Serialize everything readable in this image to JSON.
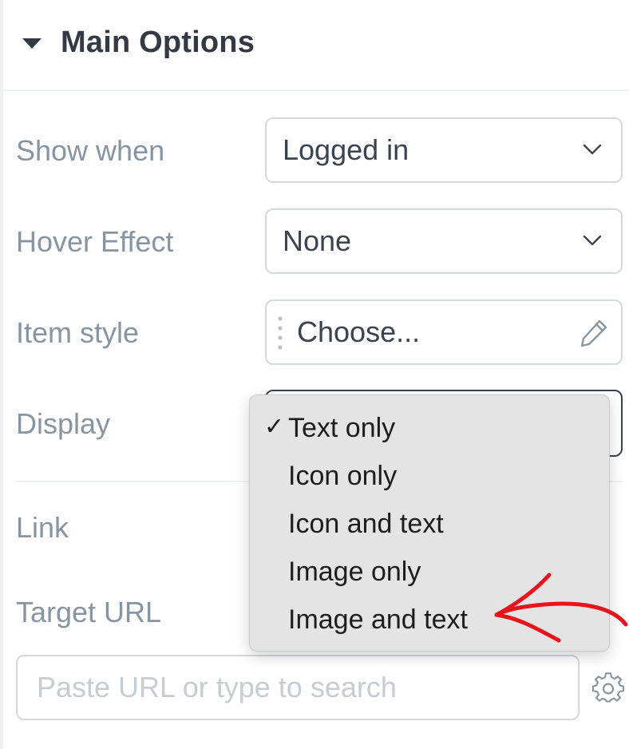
{
  "section": {
    "title": "Main Options"
  },
  "fields": {
    "show_when": {
      "label": "Show when",
      "value": "Logged in"
    },
    "hover_effect": {
      "label": "Hover Effect",
      "value": "None"
    },
    "item_style": {
      "label": "Item style",
      "value": "Choose..."
    },
    "display": {
      "label": "Display",
      "options": [
        "Text only",
        "Icon only",
        "Icon and text",
        "Image only",
        "Image and text"
      ],
      "selected": "Text only",
      "check_glyph": "✓"
    },
    "link": {
      "label": "Link"
    },
    "target_url": {
      "label": "Target URL",
      "placeholder": "Paste URL or type to search"
    }
  },
  "icons": {
    "section_toggle": "caret-down-icon",
    "select_arrow": "chevron-down-icon",
    "drag": "drag-handle-icon",
    "edit": "pencil-icon",
    "settings": "gear-icon",
    "annotation": "red-arrow-annotation"
  },
  "colors": {
    "label": "#8795a2",
    "value": "#3a4350",
    "border": "#d4d9de",
    "dropdown_bg": "#e4e4e4",
    "annotation": "#e8141b"
  }
}
